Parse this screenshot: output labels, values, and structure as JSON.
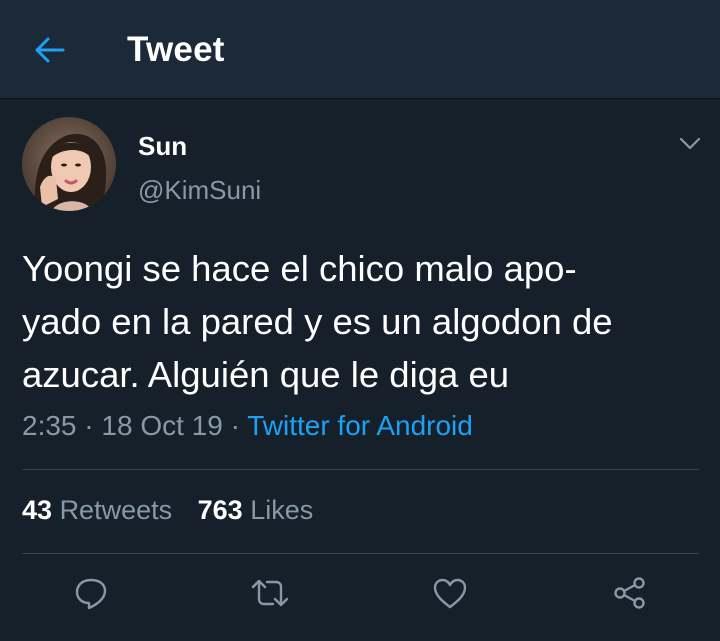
{
  "header": {
    "title": "Tweet"
  },
  "tweet": {
    "display_name": "Sun",
    "handle": "@KimSuni",
    "text": "Yoongi se hace el chico malo apo-\nyado en la pared y es un algodon de azucar. Alguién que le diga eu",
    "time": "2:35",
    "date": "18 Oct 19",
    "separator": "·",
    "source": "Twitter for Android"
  },
  "stats": {
    "retweets_count": "43",
    "retweets_label": "Retweets",
    "likes_count": "763",
    "likes_label": "Likes"
  },
  "icons": {
    "back": "arrow-left-icon",
    "caret": "chevron-down-icon",
    "reply": "reply-icon",
    "retweet": "retweet-icon",
    "like": "heart-icon",
    "share": "share-icon"
  },
  "colors": {
    "background": "#15202b",
    "header": "#1c2938",
    "accent": "#1da1f2",
    "secondary_text": "#8899a6",
    "divider": "#38444d"
  }
}
